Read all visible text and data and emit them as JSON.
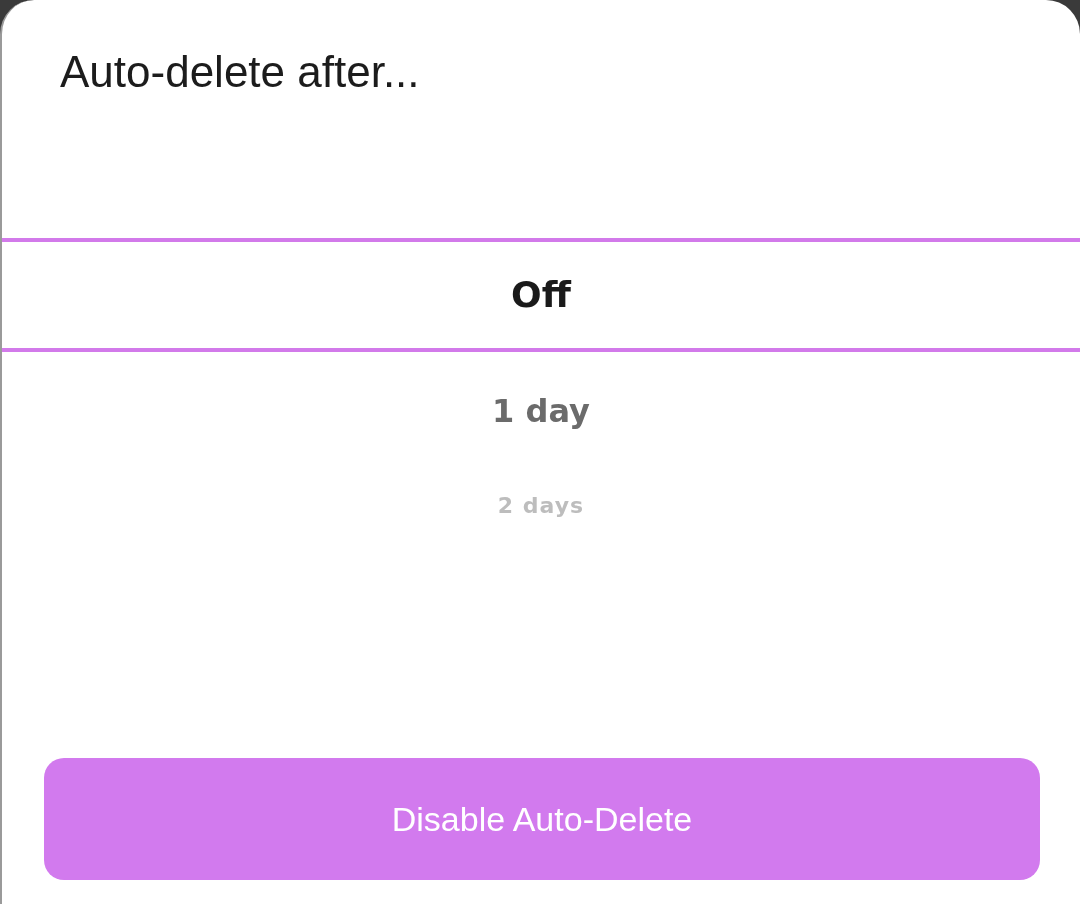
{
  "title": "Auto-delete after...",
  "picker": {
    "options": [
      {
        "label": "Off",
        "selected": true
      },
      {
        "label": "1 day",
        "selected": false
      },
      {
        "label": "2 days",
        "selected": false
      }
    ]
  },
  "button": {
    "label": "Disable Auto-Delete"
  }
}
